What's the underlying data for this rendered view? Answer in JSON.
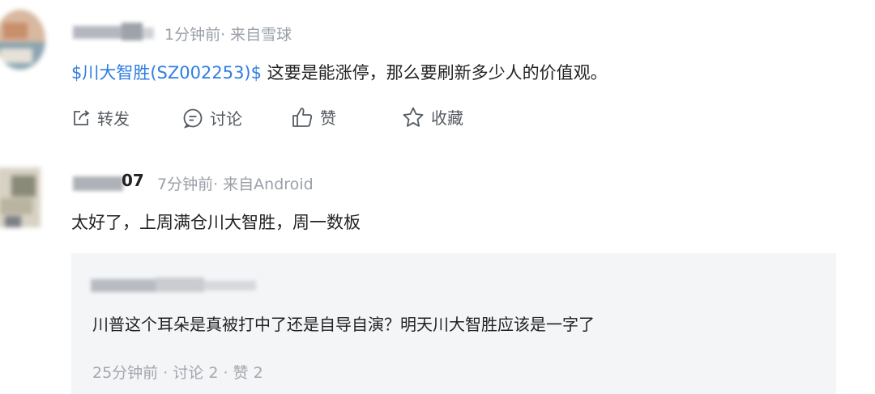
{
  "post1": {
    "time": "1分钟前",
    "source": "· 来自雪球",
    "stock_link": "$川大智胜(SZ002253)$",
    "text": " 这要是能涨停，那么要刷新多少人的价值观。",
    "actions": {
      "repost": "转发",
      "comment": "讨论",
      "like": "赞",
      "favorite": "收藏"
    }
  },
  "post2": {
    "name_suffix": "07",
    "time": "7分钟前",
    "source": "· 来自Android",
    "text": "太好了，上周满仓川大智胜，周一数板"
  },
  "quote": {
    "text": "川普这个耳朵是真被打中了还是自导自演？明天川大智胜应该是一字了",
    "time": "25分钟前",
    "comments": " · 讨论 2",
    "likes": " · 赞 2"
  },
  "colors": {
    "link": "#2f7de1",
    "meta": "#9aa0a8",
    "quote_bg": "#f4f5f7"
  }
}
